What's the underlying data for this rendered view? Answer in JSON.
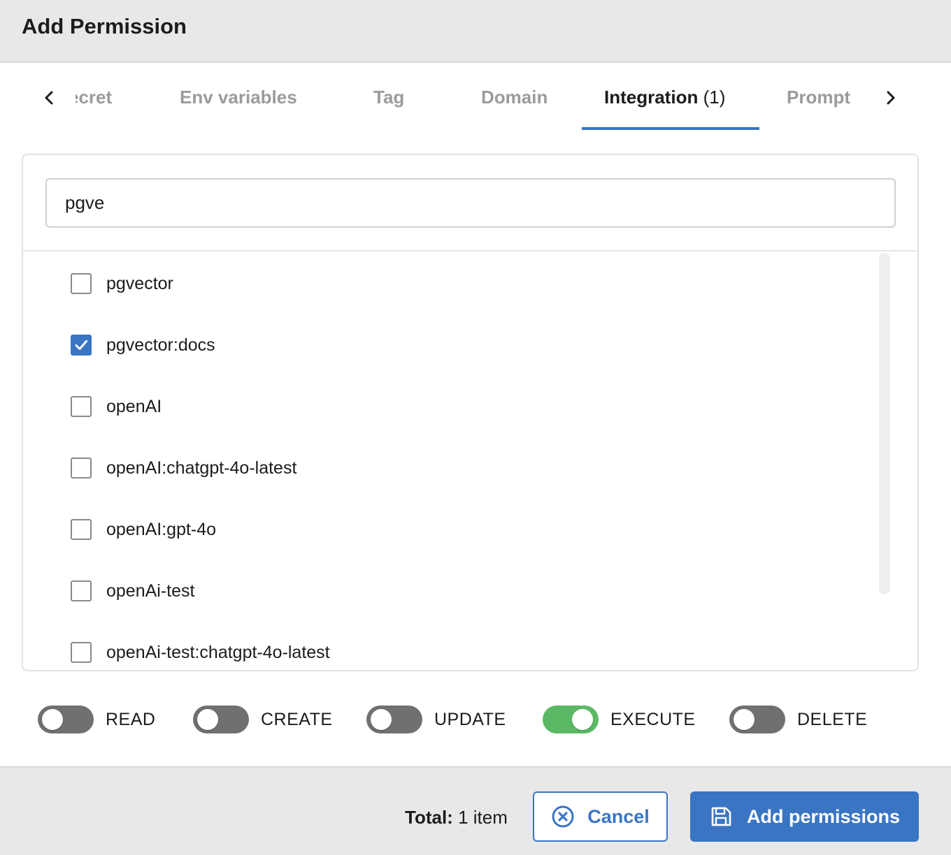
{
  "dialog": {
    "title": "Add Permission"
  },
  "tabs": {
    "items": [
      {
        "label": "ecret",
        "count": ""
      },
      {
        "label": "Env variables",
        "count": ""
      },
      {
        "label": "Tag",
        "count": ""
      },
      {
        "label": "Domain",
        "count": ""
      },
      {
        "label": "Integration",
        "count": "(1)"
      },
      {
        "label": "Prompt",
        "count": ""
      }
    ],
    "active": "Integration"
  },
  "search": {
    "value": "pgve"
  },
  "list": {
    "items": [
      {
        "label": "pgvector",
        "checked": false
      },
      {
        "label": "pgvector:docs",
        "checked": true
      },
      {
        "label": "openAI",
        "checked": false
      },
      {
        "label": "openAI:chatgpt-4o-latest",
        "checked": false
      },
      {
        "label": "openAI:gpt-4o",
        "checked": false
      },
      {
        "label": "openAi-test",
        "checked": false
      },
      {
        "label": "openAi-test:chatgpt-4o-latest",
        "checked": false
      }
    ]
  },
  "permissions": [
    {
      "label": "READ",
      "enabled": false
    },
    {
      "label": "CREATE",
      "enabled": false
    },
    {
      "label": "UPDATE",
      "enabled": false
    },
    {
      "label": "EXECUTE",
      "enabled": true
    },
    {
      "label": "DELETE",
      "enabled": false
    }
  ],
  "footer": {
    "total_label": "Total:",
    "total_value": "1 item",
    "cancel_label": "Cancel",
    "add_label": "Add permissions"
  },
  "colors": {
    "accent": "#3a75c4",
    "toggle_on": "#5bb865",
    "toggle_off": "#707070"
  },
  "icons": {
    "tab_prev": "chevron-left-icon",
    "tab_next": "chevron-right-icon",
    "cancel": "close-circle-icon",
    "add": "save-icon",
    "checkbox_checked": "checkmark-icon"
  }
}
